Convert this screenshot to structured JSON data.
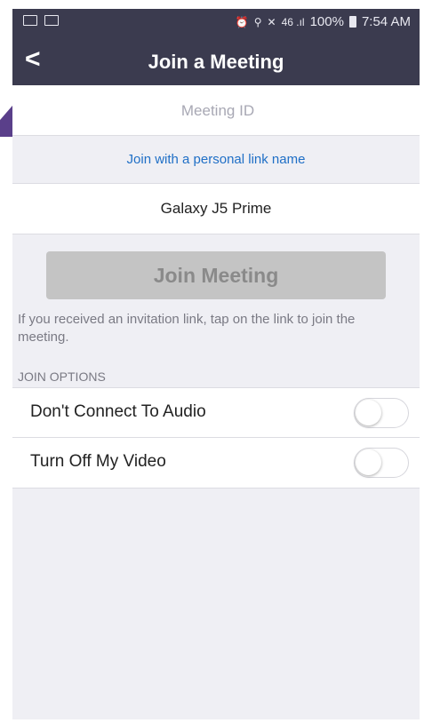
{
  "status_bar": {
    "signal_glyphs": "46 .ıl",
    "battery": "100%",
    "time": "7:54 AM"
  },
  "nav": {
    "back_icon": "chevron-left-icon",
    "back_glyph": "<",
    "title": "Join a Meeting"
  },
  "form": {
    "meeting_id_placeholder": "Meeting ID",
    "meeting_id_value": "",
    "personal_link_label": "Join with a personal link name",
    "device_name": "Galaxy J5 Prime"
  },
  "join_button_label": "Join Meeting",
  "help_text": "If you received an invitation link, tap on the link to join the meeting.",
  "join_options": {
    "header": "JOIN OPTIONS",
    "items": [
      {
        "label": "Don't Connect To Audio",
        "enabled": false
      },
      {
        "label": "Turn Off My Video",
        "enabled": false
      }
    ]
  },
  "colors": {
    "header_bg": "#3b3b4f",
    "link_blue": "#1f6fc6",
    "disabled_button": "#c4c4c4",
    "page_bg": "#efeff4"
  }
}
